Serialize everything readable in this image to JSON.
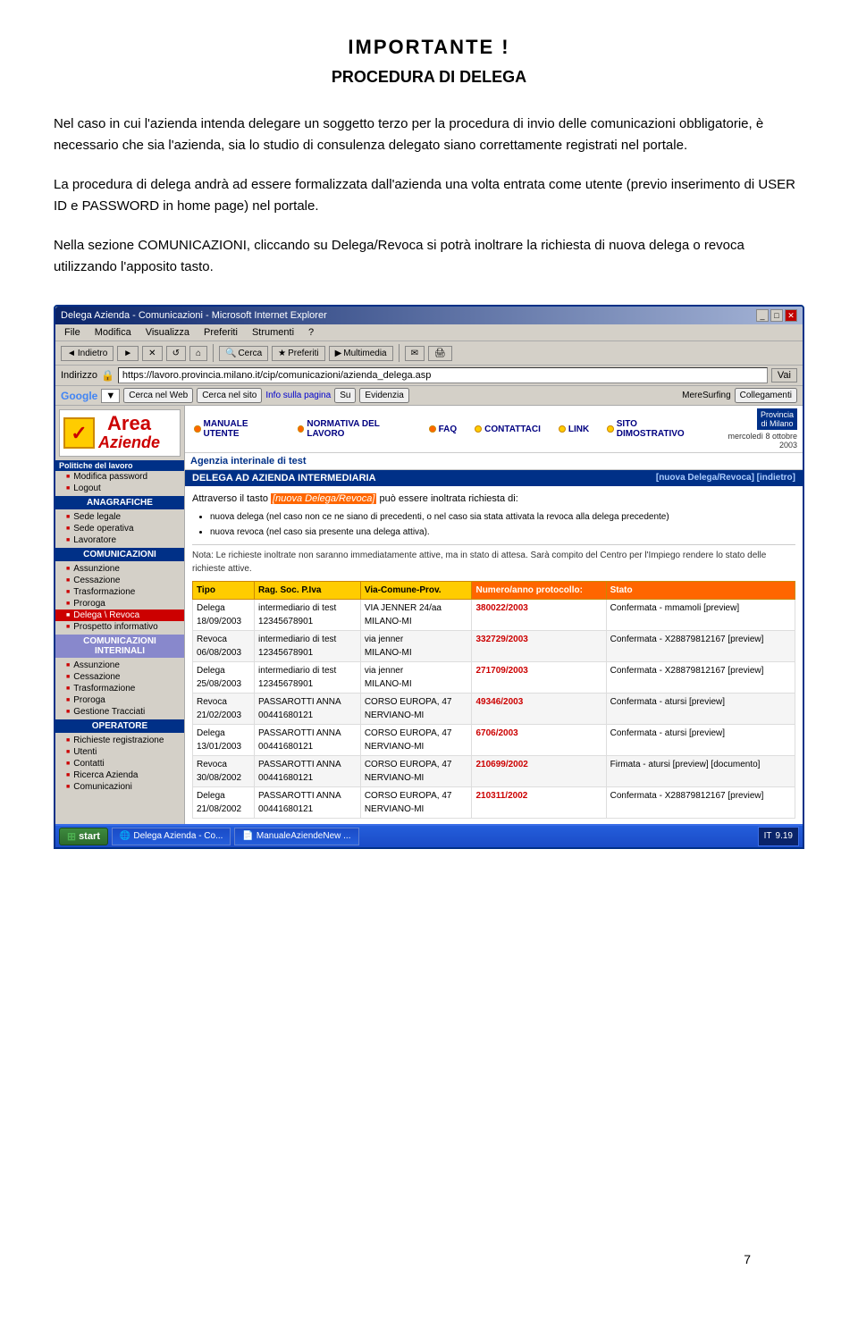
{
  "page": {
    "title_main": "IMPORTANTE !",
    "title_sub": "PROCEDURA DI DELEGA",
    "paragraph1": "Nel caso in cui l'azienda intenda delegare un soggetto terzo per la procedura di invio delle comunicazioni obbligatorie, è necessario che sia l'azienda, sia lo studio di consulenza delegato siano correttamente registrati nel portale.",
    "paragraph2": "La procedura di delega andrà ad essere formalizzata dall'azienda una volta entrata come utente (previo inserimento di USER ID e PASSWORD in home page) nel portale.",
    "paragraph3": "Nella sezione COMUNICAZIONI, cliccando su Delega/Revoca si potrà inoltrare la richiesta di nuova delega o revoca utilizzando l'apposito tasto.",
    "page_number": "7"
  },
  "browser": {
    "title": "Delega Azienda - Comunicazioni - Microsoft Internet Explorer",
    "menu_items": [
      "File",
      "Modifica",
      "Visualizza",
      "Preferiti",
      "Strumenti",
      "?"
    ],
    "toolbar": {
      "back": "Indietro",
      "forward": "",
      "stop": "✕",
      "refresh": "↺",
      "home": "⌂",
      "search": "Cerca",
      "favorites": "Preferiti",
      "multimedia": "Multimedia",
      "go_label": "Vai"
    },
    "address": {
      "label": "Indirizzo",
      "url": "https://lavoro.provincia.milano.it/cip/comunicazioni/azienda_delega.asp"
    },
    "google_bar": {
      "logo": "Google",
      "search_web": "Cerca nel Web",
      "search_site": "Cerca nel sito",
      "info": "Info sulla pagina",
      "su": "Su",
      "evidenzia": "Evidenzia"
    }
  },
  "nav": {
    "logo_area": "✓",
    "logo_area_label": "Aziende",
    "polav_label": "Politiche del lavoro",
    "items_top": [
      {
        "label": "Modifica password",
        "active": false
      },
      {
        "label": "Logout",
        "active": false
      }
    ],
    "section_anagrafiche": "ANAGRAFICHE",
    "items_anagrafiche": [
      {
        "label": "Sede legale"
      },
      {
        "label": "Sede operativa"
      },
      {
        "label": "Lavoratore"
      }
    ],
    "section_comunicazioni": "COMUNICAZIONI",
    "items_comunicazioni": [
      {
        "label": "Assunzione"
      },
      {
        "label": "Cessazione"
      },
      {
        "label": "Trasformazione"
      },
      {
        "label": "Proroga"
      },
      {
        "label": "Delega \\ Revoca",
        "active": true
      },
      {
        "label": "Prospetto informativo"
      }
    ],
    "section_comunicazioni_interne": "COMUNICAZIONI INTERINALI",
    "items_comunicazioni_interne": [
      {
        "label": "Assunzione"
      },
      {
        "label": "Cessazione"
      },
      {
        "label": "Trasformazione"
      },
      {
        "label": "Proroga"
      },
      {
        "label": "Gestione Tracciati"
      }
    ],
    "section_operatore": "OPERATORE",
    "items_operatore": [
      {
        "label": "Richieste registrazione"
      },
      {
        "label": "Utenti"
      },
      {
        "label": "Contatti"
      },
      {
        "label": "Ricerca Azienda"
      },
      {
        "label": "Comunicazioni"
      }
    ]
  },
  "top_nav": {
    "items": [
      {
        "label": "MANUALE UTENTE",
        "dot": "orange"
      },
      {
        "label": "NORMATIVA DEL LAVORO",
        "dot": "orange"
      },
      {
        "label": "FAQ",
        "dot": "orange"
      },
      {
        "label": "CONTATTACI",
        "dot": "yellow"
      },
      {
        "label": "LINK",
        "dot": "yellow"
      },
      {
        "label": "SITO DIMOSTRATIVO",
        "dot": "yellow"
      }
    ],
    "date": "mercoledì 8 ottobre 2003",
    "province": "Provincia\ndi Milano"
  },
  "content": {
    "agency": "Agenzia interinale di test",
    "title": "DELEGA AD AZIENDA INTERMEDIARIA",
    "title_links": "[nuova Delega/Revoca] [indietro]",
    "intro_text": "Attraverso il tasto",
    "intro_highlight": "[nuova Delega/Revoca]",
    "intro_text2": "può essere inoltrata richiesta di:",
    "bullet_items": [
      "nuova delega (nel caso non ce ne siano di precedenti, o nel caso sia stata attivata la revoca alla delega precedente)",
      "nuova revoca (nel caso sia presente una delega attiva)."
    ],
    "note": "Nota: Le richieste inoltrate non saranno immediatamente attive, ma in stato di attesa. Sarà compito del Centro per l'Impiego rendere lo stato delle richieste attive.",
    "table": {
      "headers": [
        "Tipo",
        "Rag. Soc. P.Iva",
        "Via-Comune-Prov.",
        "Numero/anno protocollo:",
        "Stato"
      ],
      "rows": [
        {
          "type": "Delega\n18/09/2003",
          "company": "intermediario di test\n12345678901",
          "address": "VIA JENNER 24/aa\nMILANO-MI",
          "protocol": "380022/2003",
          "status": "Confermata - mmamoli",
          "preview": "[preview]"
        },
        {
          "type": "Revoca\n06/08/2003",
          "company": "intermediario di test\n12345678901",
          "address": "via jenner\nMILANO-MI",
          "protocol": "332729/2003",
          "status": "Confermata - X28879812167",
          "preview": "[preview]"
        },
        {
          "type": "Delega\n25/08/2003",
          "company": "intermediario di test\n12345678901",
          "address": "via jenner\nMILANO-MI",
          "protocol": "271709/2003",
          "status": "Confermata - X28879812167",
          "preview": "[preview]"
        },
        {
          "type": "Revoca\n21/02/2003",
          "company": "PASSAROTTI ANNA\n00441680121",
          "address": "CORSO EUROPA, 47\nNERVIANO-MI",
          "protocol": "49346/2003",
          "status": "Confermata - atursi",
          "preview": "[preview]"
        },
        {
          "type": "Delega\n13/01/2003",
          "company": "PASSAROTTI ANNA\n00441680121",
          "address": "CORSO EUROPA, 47\nNERVIANO-MI",
          "protocol": "6706/2003",
          "status": "Confermata - atursi",
          "preview": "[preview]"
        },
        {
          "type": "Revoca\n30/08/2002",
          "company": "PASSAROTTI ANNA\n00441680121",
          "address": "CORSO EUROPA, 47\nNERVIANO-MI",
          "protocol": "210699/2002",
          "status": "Firmata - atursi",
          "preview": "[preview] [documento]"
        },
        {
          "type": "Delega\n21/08/2002",
          "company": "PASSAROTTI ANNA\n00441680121",
          "address": "CORSO EUROPA, 47\nNERVIANO-MI",
          "protocol": "210311/2002",
          "status": "Confermata - X28879812167",
          "preview": "[preview]"
        }
      ]
    }
  },
  "taskbar": {
    "start_label": "start",
    "items": [
      {
        "label": "Delega Azienda - Co..."
      },
      {
        "label": "ManualeAziendeNew ..."
      }
    ],
    "time": "9.19",
    "lang": "IT"
  }
}
